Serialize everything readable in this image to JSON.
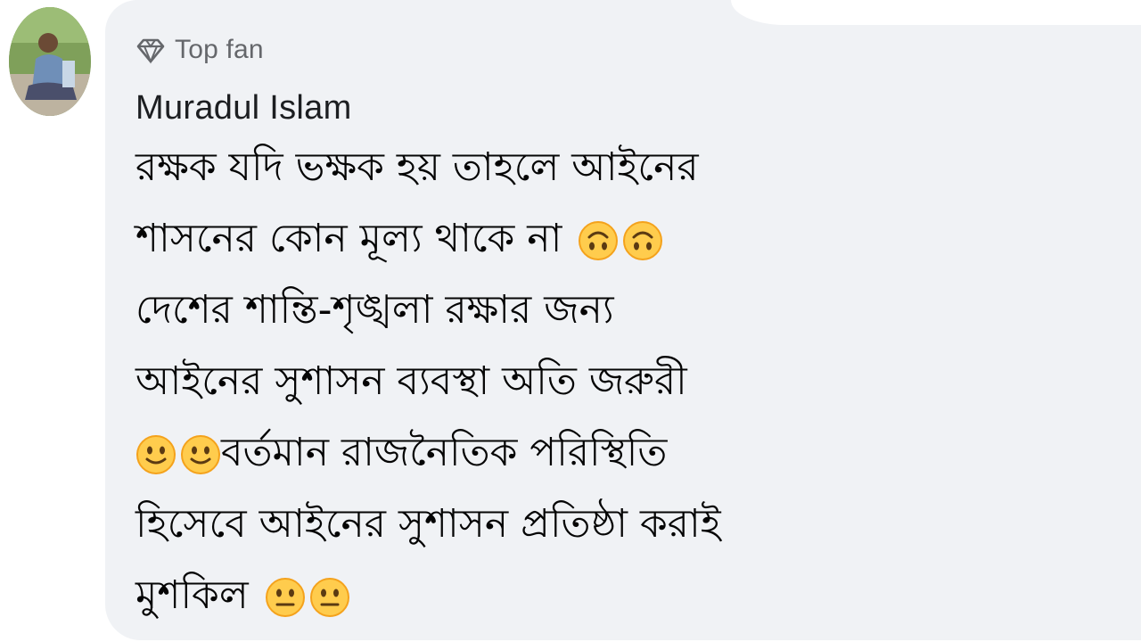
{
  "comment": {
    "badge": {
      "icon": "diamond-icon",
      "label": "Top fan"
    },
    "author": "Muradul Islam",
    "lines": [
      {
        "text": "রক্ষক যদি ভক্ষক হয় তাহলে আইনের"
      },
      {
        "text": "শাসনের কোন মূল্য থাকে না",
        "emoji_after": [
          "upside-down-face-emoji",
          "upside-down-face-emoji"
        ]
      },
      {
        "text": "দেশের শান্তি-শৃঙ্খলা রক্ষার জন্য"
      },
      {
        "text": "আইনের সুশাসন ব্যবস্থা অতি জরুরী"
      },
      {
        "text": "বর্তমান রাজনৈতিক পরিস্থিতি",
        "emoji_before": [
          "slightly-smiling-face-emoji",
          "slightly-smiling-face-emoji"
        ]
      },
      {
        "text": "হিসেবে আইনের সুশাসন প্রতিষ্ঠা করাই"
      },
      {
        "text": "মুশকিল",
        "emoji_after": [
          "neutral-face-emoji",
          "neutral-face-emoji"
        ]
      }
    ]
  },
  "colors": {
    "bubble": "#f0f2f5",
    "text": "#050505",
    "muted": "#65676b",
    "emoji_face": "#ffcc4d",
    "emoji_edge": "#f4a21c"
  }
}
